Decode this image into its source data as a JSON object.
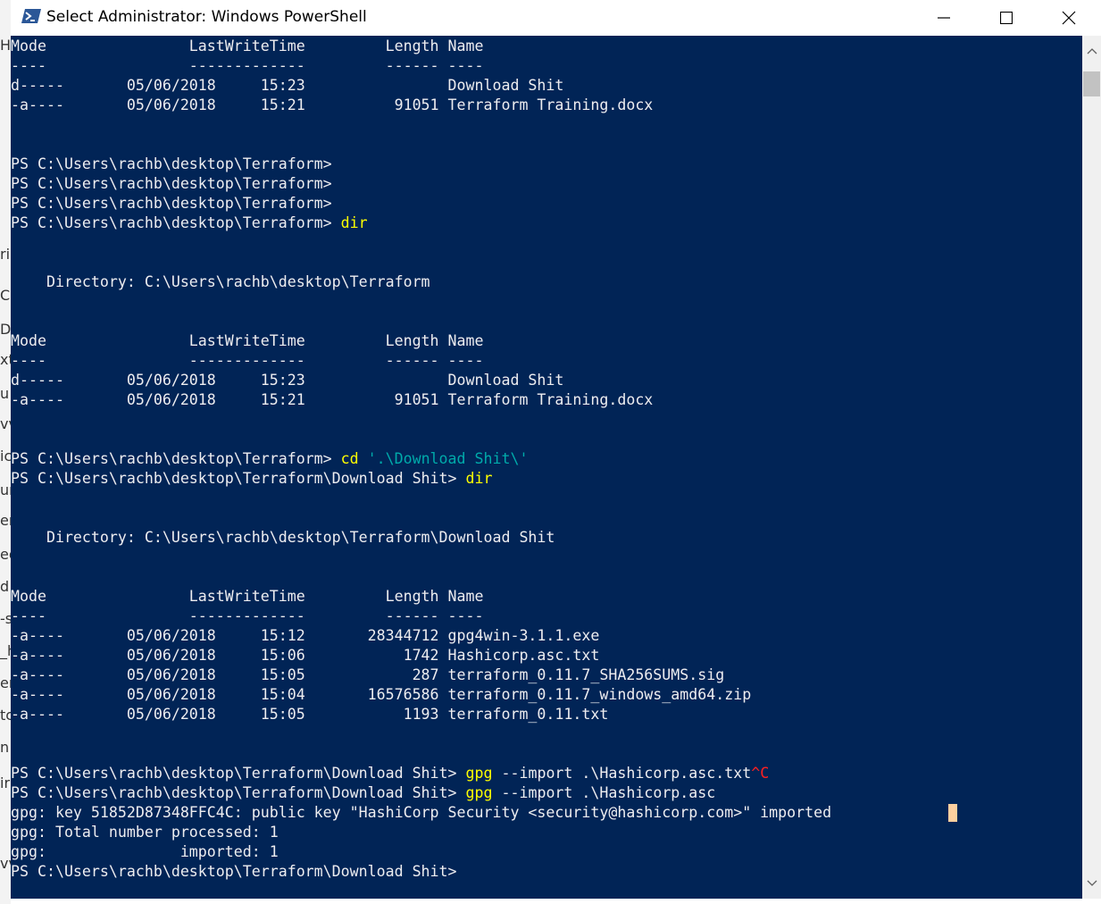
{
  "window": {
    "title": "Select Administrator: Windows PowerShell",
    "minimize_label": "—",
    "maximize_label": "☐",
    "close_label": "✕"
  },
  "colors": {
    "console_bg": "#012456",
    "console_text": "#eeedf0",
    "command": "#ffff00",
    "string": "#00aaaa",
    "ctrl_c": "#ff2020",
    "cursor": "#fecf9f"
  },
  "left_strip_fragments": [
    "He",
    "ri",
    "C",
    "D",
    "xt",
    "u",
    "vv",
    "ic",
    "ur",
    "er",
    "eo",
    "d",
    "-s",
    "_h",
    "er",
    "tc",
    "n",
    "ir",
    "vv"
  ],
  "console": {
    "lines": [
      [
        {
          "t": "Mode                LastWriteTime         Length Name"
        }
      ],
      [
        {
          "t": "----                -------------         ------ ----"
        }
      ],
      [
        {
          "t": "d-----       05/06/2018     15:23                Download Shit"
        }
      ],
      [
        {
          "t": "-a----       05/06/2018     15:21          91051 Terraform Training.docx"
        }
      ],
      [
        {
          "t": ""
        }
      ],
      [
        {
          "t": ""
        }
      ],
      [
        {
          "t": "PS C:\\Users\\rachb\\desktop\\Terraform>"
        }
      ],
      [
        {
          "t": "PS C:\\Users\\rachb\\desktop\\Terraform>"
        }
      ],
      [
        {
          "t": "PS C:\\Users\\rachb\\desktop\\Terraform>"
        }
      ],
      [
        {
          "t": "PS C:\\Users\\rachb\\desktop\\Terraform> "
        },
        {
          "t": "dir",
          "c": "cmd"
        }
      ],
      [
        {
          "t": ""
        }
      ],
      [
        {
          "t": ""
        }
      ],
      [
        {
          "t": "    Directory: C:\\Users\\rachb\\desktop\\Terraform"
        }
      ],
      [
        {
          "t": ""
        }
      ],
      [
        {
          "t": ""
        }
      ],
      [
        {
          "t": "Mode                LastWriteTime         Length Name"
        }
      ],
      [
        {
          "t": "----                -------------         ------ ----"
        }
      ],
      [
        {
          "t": "d-----       05/06/2018     15:23                Download Shit"
        }
      ],
      [
        {
          "t": "-a----       05/06/2018     15:21          91051 Terraform Training.docx"
        }
      ],
      [
        {
          "t": ""
        }
      ],
      [
        {
          "t": ""
        }
      ],
      [
        {
          "t": "PS C:\\Users\\rachb\\desktop\\Terraform> "
        },
        {
          "t": "cd",
          "c": "cmd"
        },
        {
          "t": " "
        },
        {
          "t": "'.\\Download Shit\\'",
          "c": "string"
        }
      ],
      [
        {
          "t": "PS C:\\Users\\rachb\\desktop\\Terraform\\Download Shit> "
        },
        {
          "t": "dir",
          "c": "cmd"
        }
      ],
      [
        {
          "t": ""
        }
      ],
      [
        {
          "t": ""
        }
      ],
      [
        {
          "t": "    Directory: C:\\Users\\rachb\\desktop\\Terraform\\Download Shit"
        }
      ],
      [
        {
          "t": ""
        }
      ],
      [
        {
          "t": ""
        }
      ],
      [
        {
          "t": "Mode                LastWriteTime         Length Name"
        }
      ],
      [
        {
          "t": "----                -------------         ------ ----"
        }
      ],
      [
        {
          "t": "-a----       05/06/2018     15:12       28344712 gpg4win-3.1.1.exe"
        }
      ],
      [
        {
          "t": "-a----       05/06/2018     15:06           1742 Hashicorp.asc.txt"
        }
      ],
      [
        {
          "t": "-a----       05/06/2018     15:05            287 terraform_0.11.7_SHA256SUMS.sig"
        }
      ],
      [
        {
          "t": "-a----       05/06/2018     15:04       16576586 terraform_0.11.7_windows_amd64.zip"
        }
      ],
      [
        {
          "t": "-a----       05/06/2018     15:05           1193 terraform_0.11.txt"
        }
      ],
      [
        {
          "t": ""
        }
      ],
      [
        {
          "t": ""
        }
      ],
      [
        {
          "t": "PS C:\\Users\\rachb\\desktop\\Terraform\\Download Shit> "
        },
        {
          "t": "gpg",
          "c": "cmd"
        },
        {
          "t": " --import .\\Hashicorp.asc.txt",
          "c": "param"
        },
        {
          "t": "^C",
          "c": "ctrl"
        }
      ],
      [
        {
          "t": "PS C:\\Users\\rachb\\desktop\\Terraform\\Download Shit> "
        },
        {
          "t": "gpg",
          "c": "cmd"
        },
        {
          "t": " --import .\\Hashicorp.asc",
          "c": "param"
        }
      ],
      [
        {
          "t": "gpg: key 51852D87348FFC4C: public key \"HashiCorp Security <security@hashicorp.com>\" imported"
        }
      ],
      [
        {
          "t": "gpg: Total number processed: 1"
        }
      ],
      [
        {
          "t": "gpg:               imported: 1"
        }
      ],
      [
        {
          "t": "PS C:\\Users\\rachb\\desktop\\Terraform\\Download Shit>"
        }
      ]
    ]
  }
}
